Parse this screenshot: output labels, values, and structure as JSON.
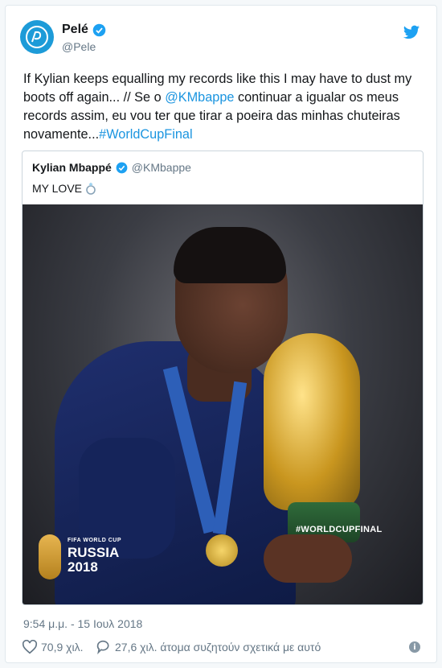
{
  "author": {
    "display_name": "Pelé",
    "handle": "@Pele",
    "verified": true
  },
  "tweet": {
    "text_before": "If Kylian keeps equalling my records like this I may have to dust my boots off again... // Se o ",
    "mention": "@KMbappe",
    "text_after": " continuar a igualar os meus records assim, eu vou ter que tirar a poeira das minhas chuteiras novamente...",
    "hashtag": "#WorldCupFinal"
  },
  "quoted_tweet": {
    "display_name": "Kylian Mbappé",
    "handle": "@KMbappe",
    "verified": true,
    "text": "MY LOVE",
    "emoji_icon": "ring-icon",
    "photo": {
      "logo_small": "FIFA WORLD CUP",
      "logo_line1": "RUSSIA",
      "logo_line2": "2018",
      "hashtag_overlay": "#WORLDCUPFINAL"
    }
  },
  "timestamp": "9:54 μ.μ. - 15 Ιουλ 2018",
  "actions": {
    "likes": "70,9 χιλ.",
    "replies": "27,6 χιλ. άτομα συζητούν σχετικά με αυτό"
  },
  "colors": {
    "link": "#1b95e0",
    "twitter_blue": "#1da1f2",
    "muted": "#657786"
  }
}
